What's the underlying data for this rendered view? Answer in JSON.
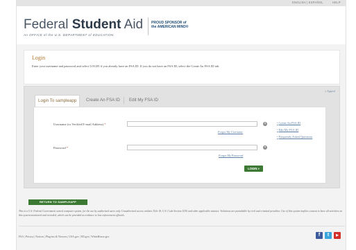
{
  "utility_bar": {
    "language_label": "ENGLISH | ESPAÑOL",
    "help_label": "HELP"
  },
  "header": {
    "logo_part1": "Federal ",
    "logo_part2": "Student",
    "logo_part3": " Aid",
    "logo_subtitle": "An OFFICE of the U.S. DEPARTMENT of EDUCATION",
    "sponsor_line1": "PROUD SPONSOR of",
    "sponsor_line2": "the AMERICAN MIND®"
  },
  "login_header": {
    "title": "Login",
    "description": "Enter your username and password and select LOGIN if you already have an FSA ID. If you do not have an FSA ID, select the Create An FSA ID tab."
  },
  "card": {
    "appeal_link": "» Appeal",
    "tabs": [
      {
        "label": "Login To sampleapp",
        "active": true
      },
      {
        "label": "Create An FSA ID",
        "active": false
      },
      {
        "label": "Edit My FSA ID",
        "active": false
      }
    ],
    "username_label": "Username (or Verified E-mail Address)",
    "password_label": "Password",
    "required_marker": "*",
    "forgot_username": "Forgot My Username",
    "forgot_password": "Forgot My Password",
    "side_links": [
      "Create An FSA ID",
      "Edit My FSA ID",
      "Frequently Asked Questions"
    ],
    "login_button": "LOGIN »"
  },
  "return_button": "RETURN TO SAMPLEAPP",
  "disclaimer": "This is a U.S. Federal Government owned computer system, for the use by authorized users only. Unauthorized access violates Title 18, U.S. Code Section 1030 and other applicable statutes. Violations are punishable by civil and criminal penalties. Use of this system implies consent to have all activities on this system monitored and recorded, which can be provided as evidence to law enforcement officials.",
  "footer": {
    "links": "FSA  |  Privacy  |  Notices  |  Plug-ins & Viewers  |  USA.gov  |  ED.gov  |  WhiteHouse.gov"
  },
  "social_icons": [
    "facebook-icon",
    "twitter-icon",
    "youtube-icon"
  ]
}
